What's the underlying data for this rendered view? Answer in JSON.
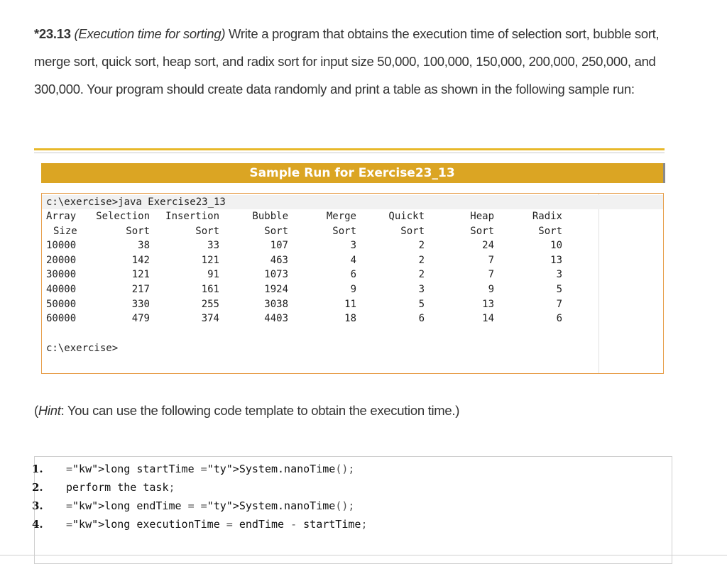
{
  "problem": {
    "number": "*23.13",
    "title": "(Execution time for sorting)",
    "text": " Write a program that obtains the execution time of selection sort, bubble sort, merge sort, quick sort, heap sort, and radix sort for input size 50,000, 100,000, 150,000, 200,000, 250,000, and 300,000. Your program should create data randomly and print a table as shown in the following sample run:"
  },
  "sample_run": {
    "header": "Sample Run for Exercise23_13",
    "command": "c:\\exercise>java Exercise23_13",
    "prompt": "c:\\exercise>",
    "columns": [
      {
        "h1": "Array",
        "h2": "Size",
        "values": [
          "10000",
          "20000",
          "30000",
          "40000",
          "50000",
          "60000"
        ]
      },
      {
        "h1": "Selection",
        "h2": "Sort",
        "values": [
          "38",
          "142",
          "121",
          "217",
          "330",
          "479"
        ]
      },
      {
        "h1": "Insertion",
        "h2": "Sort",
        "values": [
          "33",
          "121",
          "91",
          "161",
          "255",
          "374"
        ]
      },
      {
        "h1": "Bubble",
        "h2": "Sort",
        "values": [
          "107",
          "463",
          "1073",
          "1924",
          "3038",
          "4403"
        ]
      },
      {
        "h1": "Merge",
        "h2": "Sort",
        "values": [
          "3",
          "4",
          "6",
          "9",
          "11",
          "18"
        ]
      },
      {
        "h1": "Quickt",
        "h2": "Sort",
        "values": [
          "2",
          "2",
          "2",
          "3",
          "5",
          "6"
        ]
      },
      {
        "h1": "Heap",
        "h2": "Sort",
        "values": [
          "24",
          "7",
          "7",
          "9",
          "13",
          "14"
        ]
      },
      {
        "h1": "Radix",
        "h2": "Sort",
        "values": [
          "10",
          "13",
          "3",
          "5",
          "7",
          "6"
        ]
      }
    ]
  },
  "hint": {
    "word": "Hint",
    "text": ": You can use the following code template to obtain the execution time.)",
    "open_paren": "("
  },
  "code": {
    "lines": [
      {
        "num": "1.",
        "text": "long startTime System.nanoTime();"
      },
      {
        "num": "2.",
        "text": "perform the task;"
      },
      {
        "num": "3.",
        "text": "long endTime = System.nanoTime();"
      },
      {
        "num": "4.",
        "text": "long executionTime = endTime - startTime;"
      }
    ]
  }
}
